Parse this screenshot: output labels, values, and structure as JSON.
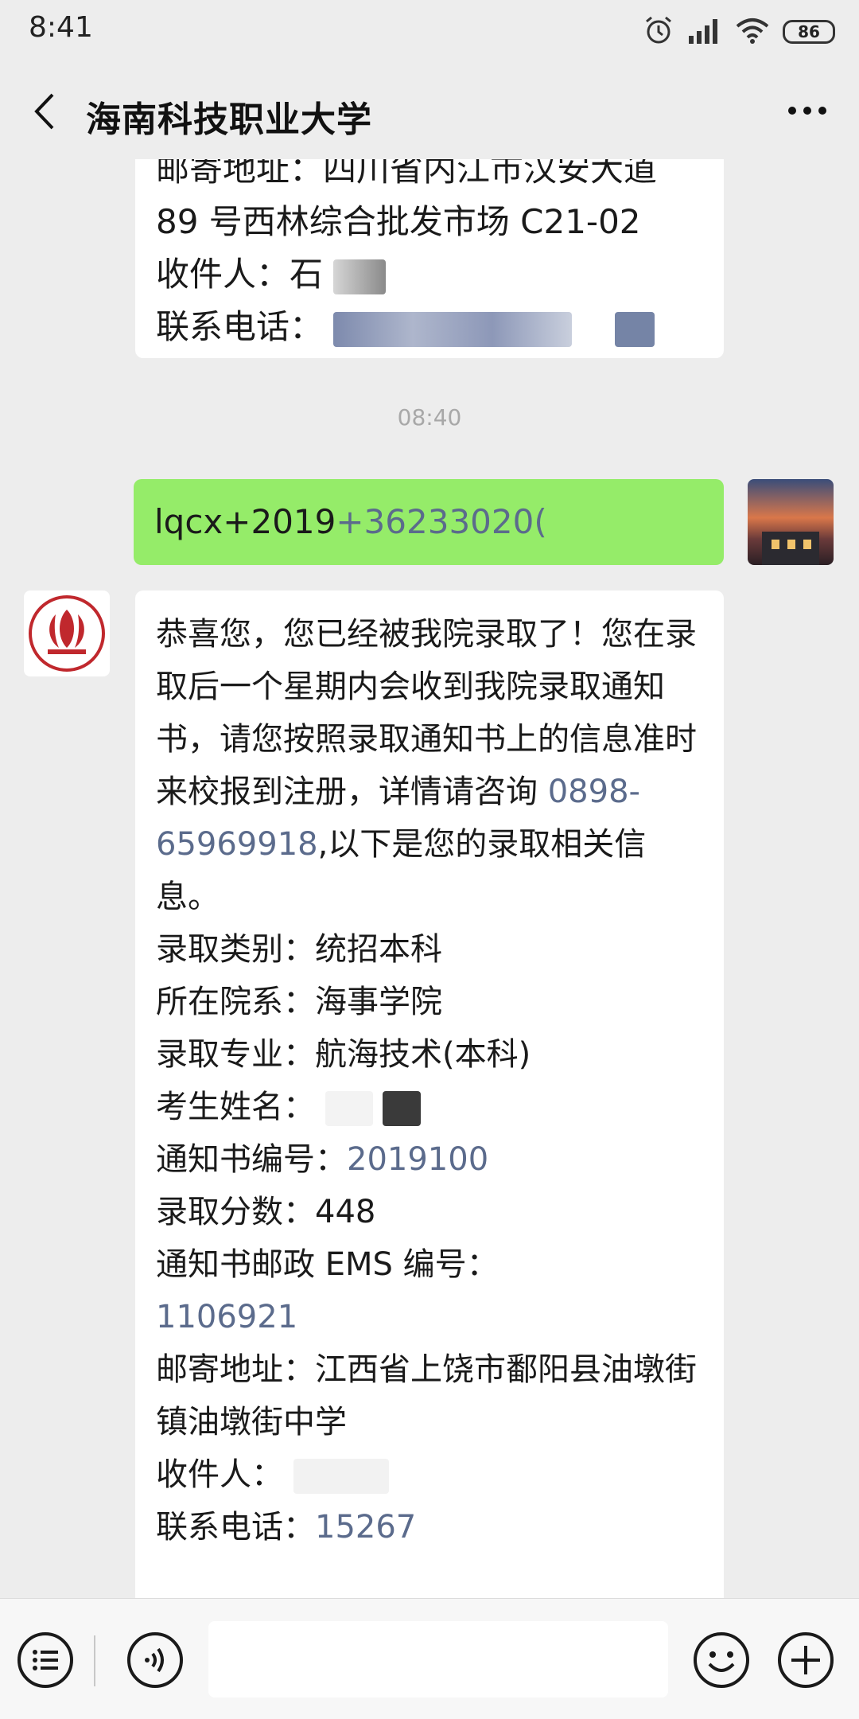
{
  "status_bar": {
    "time": "8:41",
    "battery": "86"
  },
  "header": {
    "title": "海南科技职业大学"
  },
  "messages": {
    "prev_bubble": {
      "line_partial": "邮寄地址：四川省内江市汉安大道",
      "line_address": "89 号西林综合批发市场 C21-02",
      "recipient_label": "收件人：石",
      "phone_label": "联系电话："
    },
    "timestamp": "08:40",
    "sent": {
      "prefix": "lqcx+2019",
      "link": "+36233020("
    },
    "received": {
      "intro_text_1": "恭喜您，您已经被我院录取了！您在录取后一个星期内会收到我院录取通知书，请您按照录取通知书上的信息准时来校报到注册，详情请咨询",
      "phone_link": "0898-65969918",
      "intro_text_2": ",以下是您的录取相关信息。",
      "category_label": "录取类别：",
      "category_value": "统招本科",
      "department_label": "所在院系：",
      "department_value": "海事学院",
      "major_label": "录取专业：",
      "major_value": "航海技术(本科)",
      "name_label": "考生姓名：",
      "notice_no_label": "通知书编号：",
      "notice_no_value": "2019100",
      "score_label": "录取分数：",
      "score_value": "448",
      "ems_label": "通知书邮政 EMS 编号：",
      "ems_value": "1106921",
      "address_label": "邮寄地址：",
      "address_value": "江西省上饶市鄱阳县油墩街镇油墩街中学",
      "recipient_label": "收件人：",
      "phone_label": "联系电话：",
      "phone_value": "15267"
    }
  },
  "colors": {
    "background": "#ededed",
    "sent_bubble": "#95ec69",
    "link": "#5b6b8c",
    "logo_red": "#c0282d"
  },
  "icons": [
    "back-arrow-icon",
    "more-icon",
    "alarm-icon",
    "signal-icon",
    "wifi-icon",
    "list-icon",
    "voice-icon",
    "emoji-icon",
    "plus-icon",
    "school-logo-icon"
  ]
}
